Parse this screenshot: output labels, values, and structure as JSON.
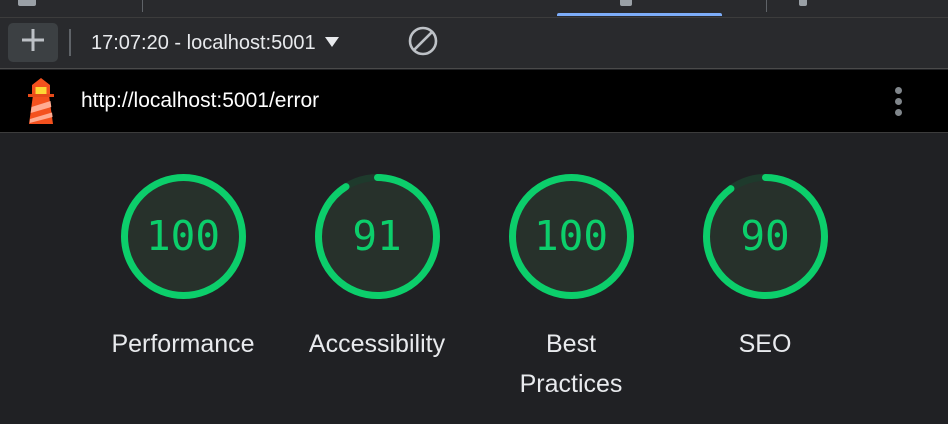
{
  "toolbar": {
    "report_label": "17:07:20 - localhost:5001"
  },
  "report": {
    "url": "http://localhost:5001/error"
  },
  "colors": {
    "pass": "#0cce6b",
    "gauge_track": "#1e3a2c",
    "gauge_fill": "#27312b",
    "label_text": "#e8eaed"
  },
  "categories": [
    {
      "name": "Performance",
      "score": "100",
      "value": 1.0
    },
    {
      "name": "Accessibility",
      "score": "91",
      "value": 0.91
    },
    {
      "name": "Best Practices",
      "score": "100",
      "value": 1.0
    },
    {
      "name": "SEO",
      "score": "90",
      "value": 0.9
    }
  ]
}
